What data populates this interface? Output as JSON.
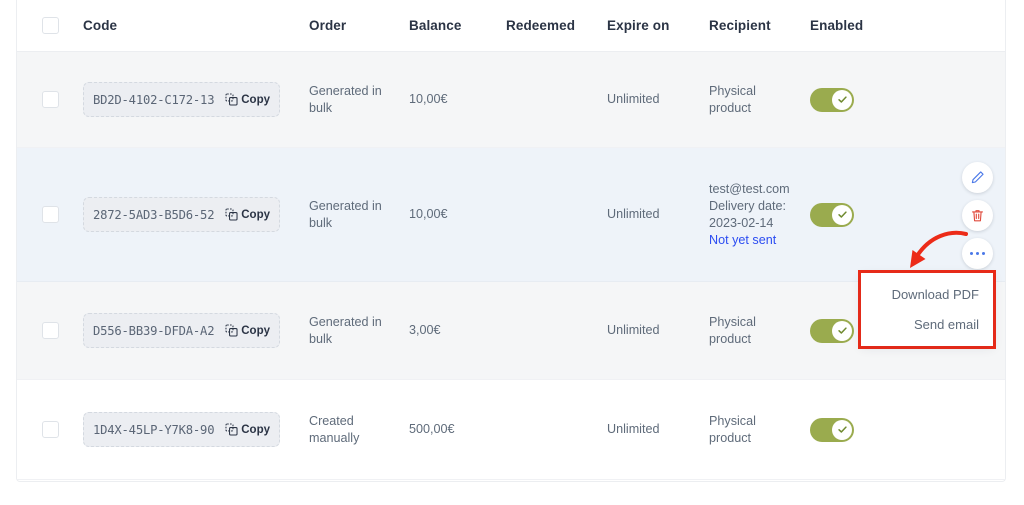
{
  "table": {
    "columns": [
      {
        "key": "checkbox",
        "label": ""
      },
      {
        "key": "code",
        "label": "Code"
      },
      {
        "key": "order",
        "label": "Order"
      },
      {
        "key": "balance",
        "label": "Balance"
      },
      {
        "key": "redeemed",
        "label": "Redeemed"
      },
      {
        "key": "expire_on",
        "label": "Expire on"
      },
      {
        "key": "recipient",
        "label": "Recipient"
      },
      {
        "key": "enabled",
        "label": "Enabled"
      }
    ],
    "copy_label": "Copy",
    "rows": [
      {
        "code": "BD2D-4102-C172-13",
        "order": "Generated in bulk",
        "balance": "10,00€",
        "redeemed": "",
        "expire_on": "Unlimited",
        "recipient": "Physical product",
        "recipient_extra": "",
        "recipient_status": "",
        "enabled": true
      },
      {
        "code": "2872-5AD3-B5D6-52",
        "order": "Generated in bulk",
        "balance": "10,00€",
        "redeemed": "",
        "expire_on": "Unlimited",
        "recipient": "test@test.com",
        "recipient_extra": "Delivery date: 2023-02-14",
        "recipient_status": "Not yet sent",
        "enabled": true
      },
      {
        "code": "D556-BB39-DFDA-A2",
        "order": "Generated in bulk",
        "balance": "3,00€",
        "redeemed": "",
        "expire_on": "Unlimited",
        "recipient": "Physical product",
        "recipient_extra": "",
        "recipient_status": "",
        "enabled": true
      },
      {
        "code": "1D4X-45LP-Y7K8-90",
        "order": "Created manually",
        "balance": "500,00€",
        "redeemed": "",
        "expire_on": "Unlimited",
        "recipient": "Physical product",
        "recipient_extra": "",
        "recipient_status": "",
        "enabled": true
      }
    ]
  },
  "row_actions": {
    "edit_tooltip": "Edit",
    "delete_tooltip": "Delete",
    "more_tooltip": "More actions"
  },
  "dropdown_menu": {
    "items": [
      {
        "label": "Download PDF"
      },
      {
        "label": "Send email"
      }
    ]
  },
  "colors": {
    "toggle_on": "#9aab4e",
    "highlight_border": "#ec2b18",
    "arrow": "#ec2b18",
    "link": "#2b4cf2",
    "edit_icon": "#4a78e8",
    "delete_icon": "#e04b3d",
    "row_selected_bg": "#eef3f9",
    "row_alt_bg": "#f5f6f7"
  }
}
